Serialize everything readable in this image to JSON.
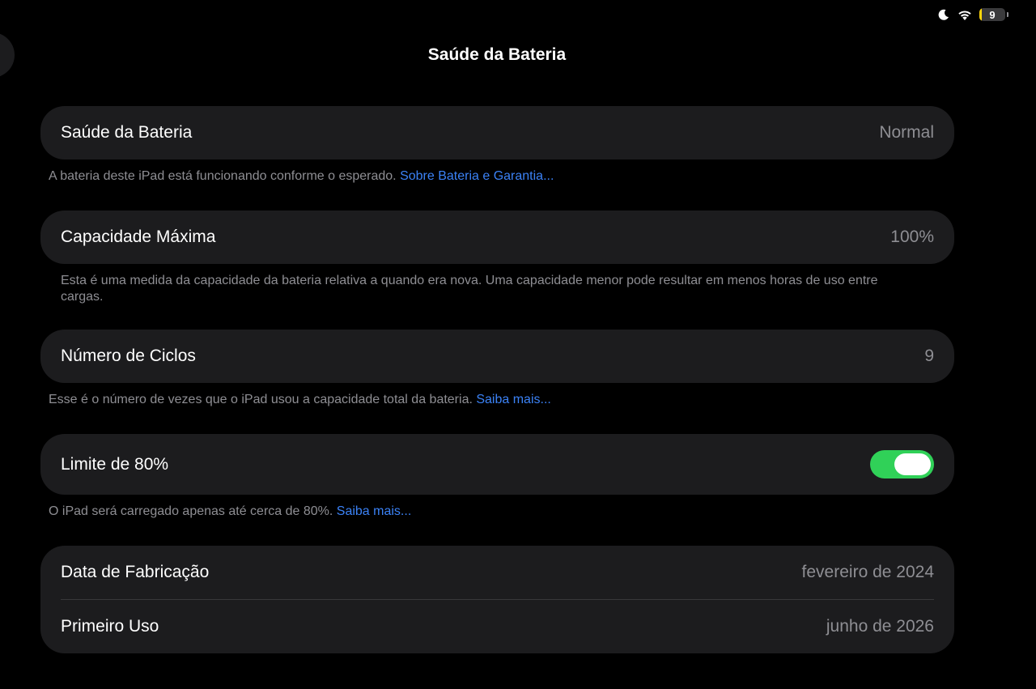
{
  "status_bar": {
    "focus_icon": "moon-icon",
    "wifi_icon": "wifi-icon",
    "battery_level": "9",
    "battery_percent": 9,
    "battery_color": "#ffd60a"
  },
  "header": {
    "title": "Saúde da Bateria"
  },
  "battery_health": {
    "label": "Saúde da Bateria",
    "value": "Normal",
    "note": "A bateria deste iPad está funcionando conforme o esperado.",
    "link": "Sobre Bateria e Garantia..."
  },
  "max_capacity": {
    "label": "Capacidade Máxima",
    "value": "100%",
    "note": "Esta é uma medida da capacidade da bateria relativa a quando era nova. Uma capacidade menor pode resultar em menos horas de uso entre cargas."
  },
  "cycle_count": {
    "label": "Número de Ciclos",
    "value": "9",
    "note": "Esse é o número de vezes que o iPad usou a capacidade total da bateria.",
    "link": "Saiba mais..."
  },
  "limit_80": {
    "label": "Limite de 80%",
    "enabled": true,
    "toggle_color": "#30d158",
    "note": "O iPad será carregado apenas até cerca de 80%.",
    "link": "Saiba mais..."
  },
  "dates": {
    "manufacture_label": "Data de Fabricação",
    "manufacture_value": "fevereiro de 2024",
    "first_use_label": "Primeiro Uso",
    "first_use_value": "junho de 2026"
  },
  "colors": {
    "background": "#000000",
    "card": "#1c1c1e",
    "link": "#3b82f6",
    "secondary_text": "#8e8e93"
  }
}
